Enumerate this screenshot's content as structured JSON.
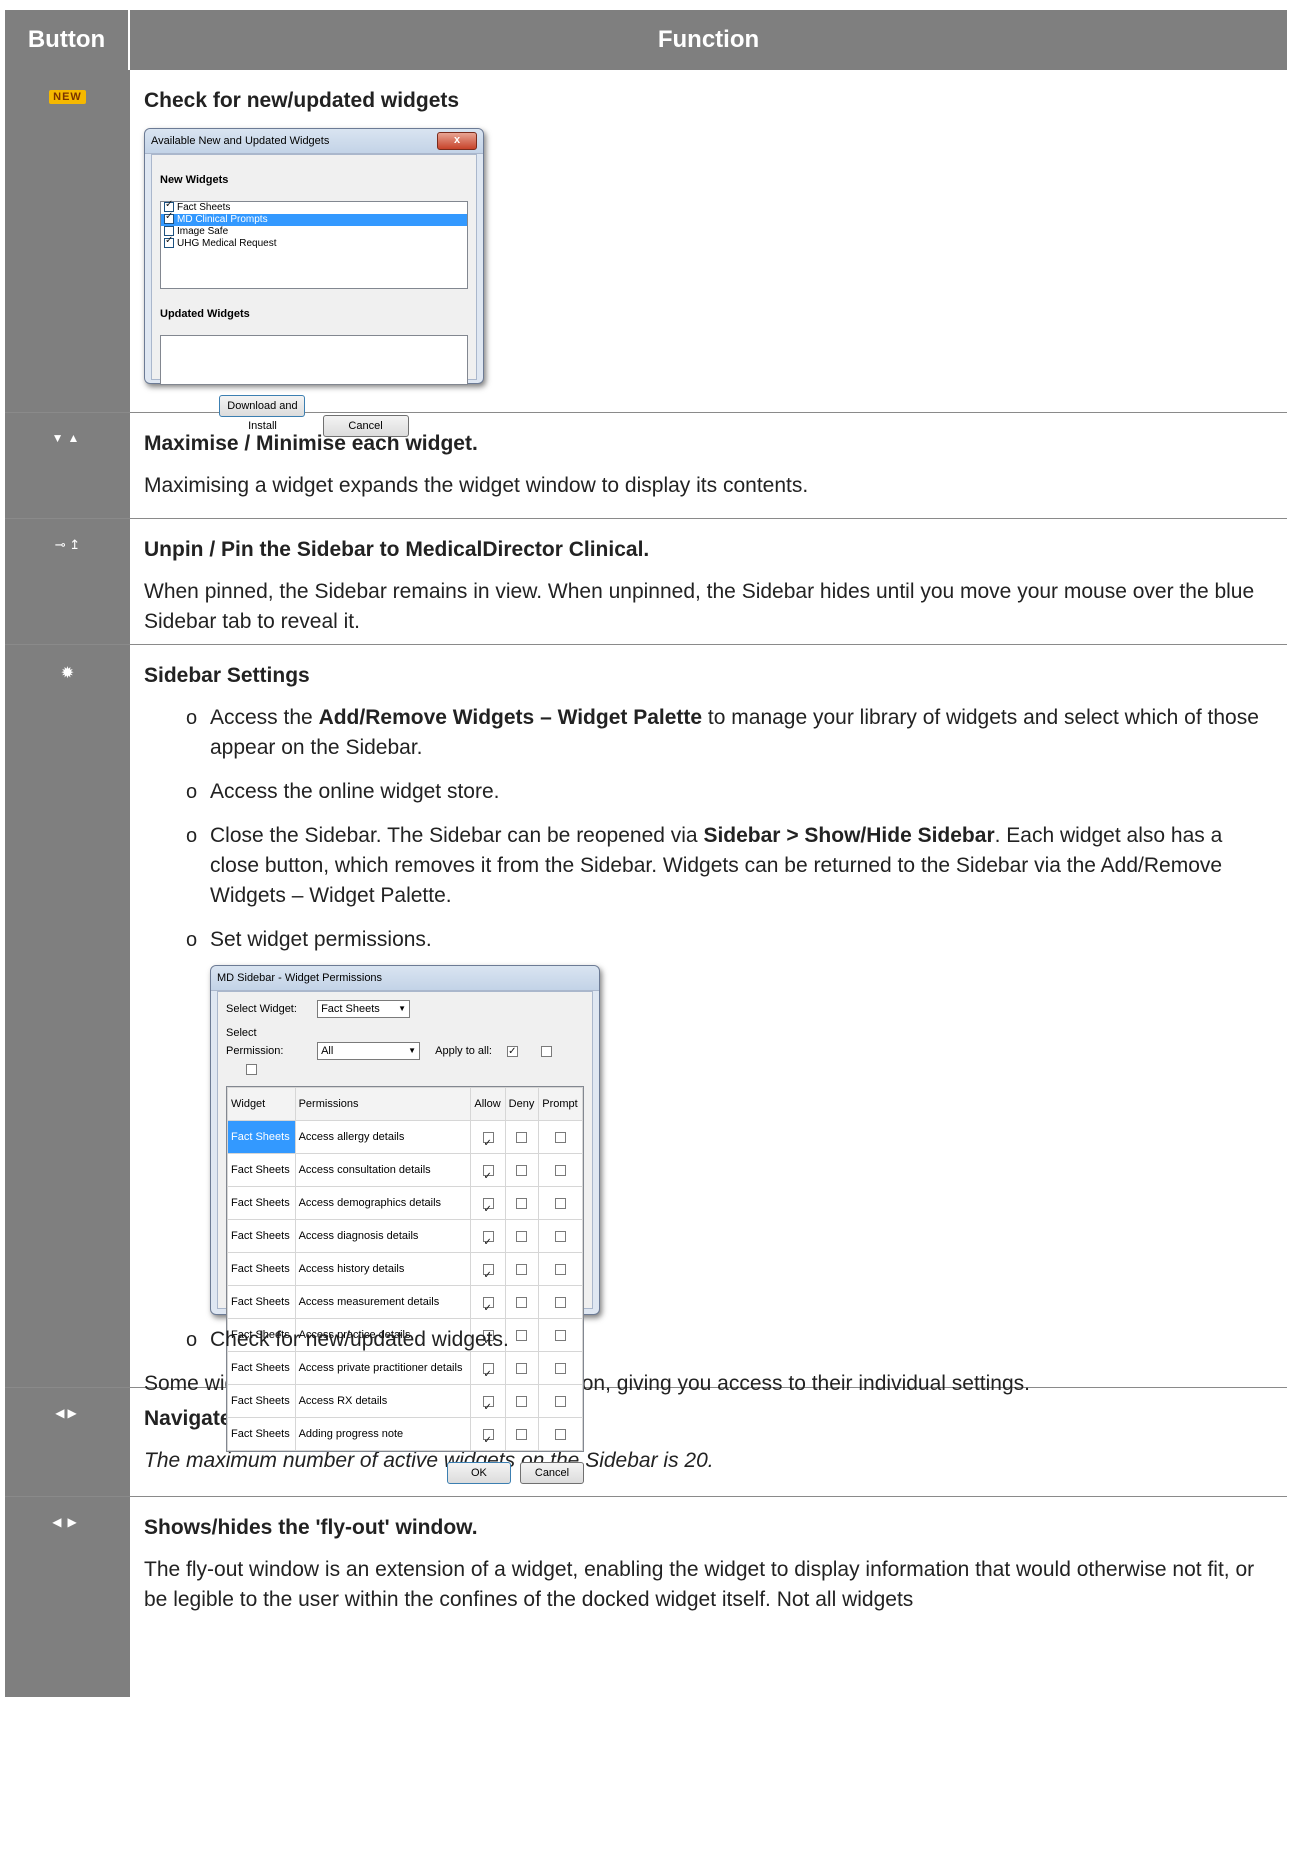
{
  "header": {
    "col_button": "Button",
    "col_function": "Function"
  },
  "row_new": {
    "icon_label": "NEW",
    "title": "Check for new/updated widgets",
    "dialog": {
      "title": "Available New and Updated Widgets",
      "close": "x",
      "new_heading": "New Widgets",
      "new_items": [
        {
          "label": "Fact Sheets",
          "checked": true
        },
        {
          "label": "MD Clinical Prompts",
          "checked": true
        },
        {
          "label": "Image Safe",
          "checked": false
        },
        {
          "label": "UHG Medical Request",
          "checked": true
        }
      ],
      "updated_heading": "Updated Widgets",
      "btn_install": "Download and Install",
      "btn_cancel": "Cancel"
    }
  },
  "row_maximise": {
    "title": "Maximise / Minimise each widget.",
    "text": "Maximising a widget expands the widget window to display its contents."
  },
  "row_pin": {
    "title": "Unpin / Pin the Sidebar to MedicalDirector Clinical.",
    "text": "When pinned, the Sidebar remains in view. When unpinned, the Sidebar hides until you move your mouse over the blue Sidebar tab to reveal it."
  },
  "row_settings": {
    "title": "Sidebar Settings",
    "b1_pre": "Access the ",
    "b1_bold": "Add/Remove Widgets – Widget Palette",
    "b1_post": " to manage your library of widgets and select which of those appear on the Sidebar.",
    "b2": "Access the online widget store.",
    "b3_pre": "Close the Sidebar. The Sidebar can be reopened via ",
    "b3_bold": "Sidebar > Show/Hide Sidebar",
    "b3_post": ". Each widget also has a close button, which removes it from the Sidebar. Widgets can be returned to the Sidebar via the Add/Remove Widgets – Widget Palette.",
    "b4": "Set widget permissions.",
    "b5": "Check for new/updated widgets.",
    "footer": "Some widgets also have their own settings button, giving you access to their individual settings.",
    "perm_dialog": {
      "title": "MD Sidebar - Widget Permissions",
      "select_widget_label": "Select Widget:",
      "select_widget_value": "Fact Sheets",
      "select_perm_label": "Select Permission:",
      "select_perm_value": "All",
      "apply_all": "Apply to all:",
      "cols": [
        "Widget",
        "Permissions",
        "Allow",
        "Deny",
        "Prompt"
      ],
      "rows": [
        [
          "Fact Sheets",
          "Access allergy details"
        ],
        [
          "Fact Sheets",
          "Access consultation details"
        ],
        [
          "Fact Sheets",
          "Access demographics details"
        ],
        [
          "Fact Sheets",
          "Access diagnosis details"
        ],
        [
          "Fact Sheets",
          "Access history details"
        ],
        [
          "Fact Sheets",
          "Access measurement details"
        ],
        [
          "Fact Sheets",
          "Access practice details"
        ],
        [
          "Fact Sheets",
          "Access private practitioner details"
        ],
        [
          "Fact Sheets",
          "Access RX details"
        ],
        [
          "Fact Sheets",
          "Adding progress note"
        ]
      ],
      "btn_ok": "OK",
      "btn_cancel": "Cancel"
    }
  },
  "row_nav": {
    "title": "Navigate through multiple pages of widgets.",
    "text": "The maximum number of active widgets on the Sidebar is 20."
  },
  "row_flyout": {
    "title": "Shows/hides the 'fly-out' window.",
    "text": "The fly-out window is an extension of a widget, enabling the widget to display information that would otherwise not fit, or be legible to the user within the confines of the docked widget itself. Not all widgets"
  },
  "colors": {
    "header_bg": "#7f7f7f",
    "new_badge": "#f5b800",
    "selected_row": "#3399ff"
  }
}
